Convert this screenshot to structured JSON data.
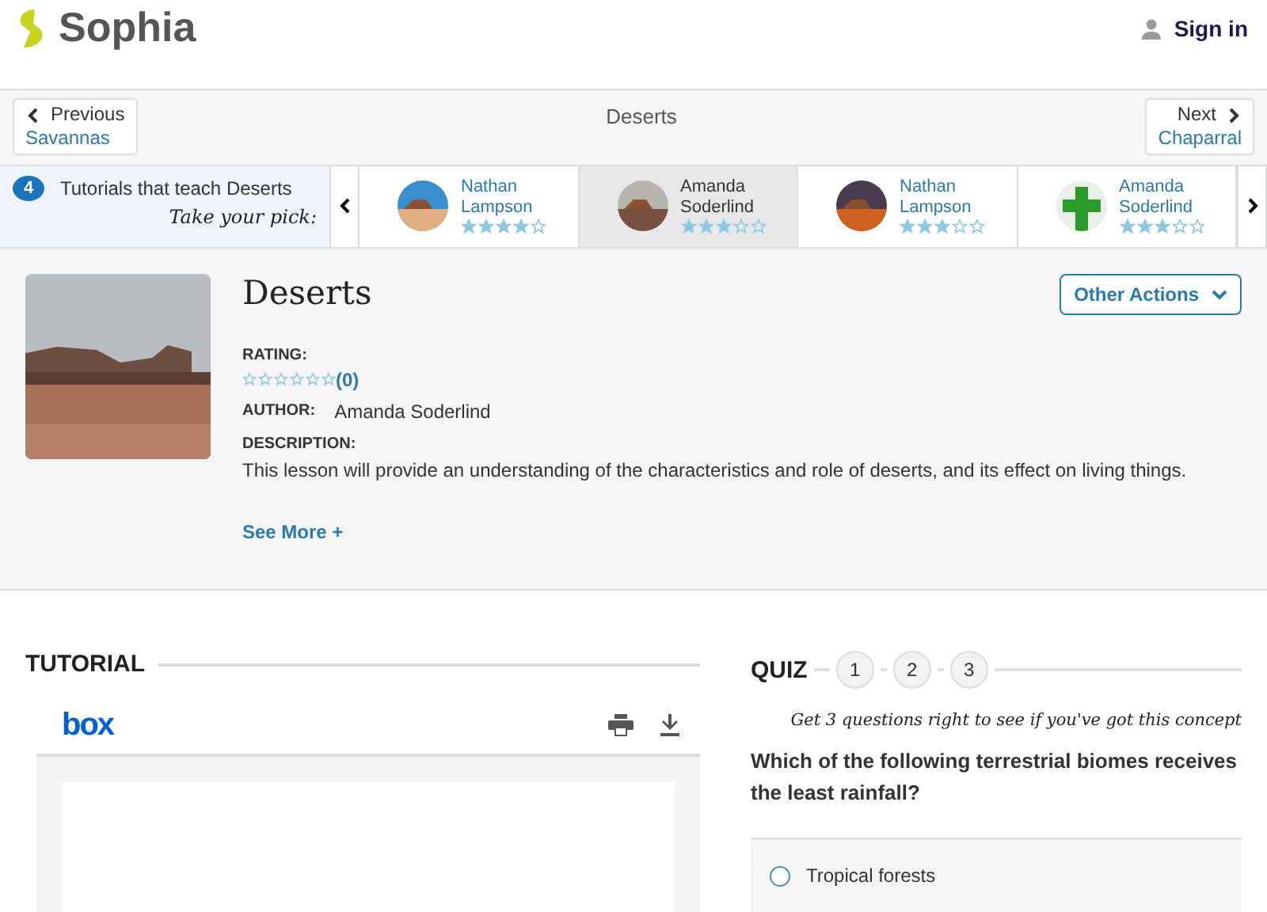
{
  "header": {
    "logo": "Sophia",
    "sign_in": "Sign in"
  },
  "nav": {
    "previous": {
      "label": "Previous",
      "target": "Savannas"
    },
    "title": "Deserts",
    "next": {
      "label": "Next",
      "target": "Chaparral"
    }
  },
  "tutorials_strip": {
    "count": "4",
    "label": "Tutorials that teach Deserts",
    "tagline": "Take your pick:",
    "items": [
      {
        "name": "Nathan Lampson",
        "stars": 4,
        "selected": false
      },
      {
        "name": "Amanda Soderlind",
        "stars": 3,
        "selected": true
      },
      {
        "name": "Nathan Lampson",
        "stars": 3,
        "selected": false
      },
      {
        "name": "Amanda Soderlind",
        "stars": 3,
        "selected": false
      }
    ]
  },
  "lesson": {
    "title": "Deserts",
    "actions": "Other Actions",
    "rating_label": "RATING:",
    "stars": 0,
    "rating_count": "(0)",
    "author_label": "AUTHOR:",
    "author": "Amanda Soderlind",
    "description_label": "DESCRIPTION:",
    "description": "This lesson will provide an understanding of the characteristics and role of deserts, and its effect on living things.",
    "see_more": "See More +"
  },
  "tutorial": {
    "heading": "TUTORIAL",
    "viewer_logo": "box"
  },
  "quiz": {
    "heading": "QUIZ",
    "steps": [
      "1",
      "2",
      "3"
    ],
    "tagline": "Get 3 questions right to see if you've got this concept",
    "question": "Which of the following terrestrial biomes receives the least rainfall?",
    "options": [
      {
        "text": "Tropical forests",
        "selected": false
      }
    ]
  }
}
